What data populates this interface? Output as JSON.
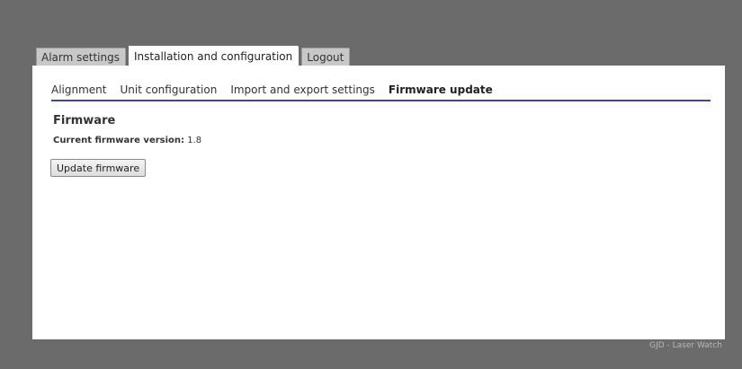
{
  "top_tabs": [
    {
      "label": "Alarm settings",
      "active": false
    },
    {
      "label": "Installation and configuration",
      "active": true
    },
    {
      "label": "Logout",
      "active": false
    }
  ],
  "sub_nav": [
    {
      "label": "Alignment",
      "active": false
    },
    {
      "label": "Unit configuration",
      "active": false
    },
    {
      "label": "Import and export settings",
      "active": false
    },
    {
      "label": "Firmware update",
      "active": true
    }
  ],
  "section": {
    "title": "Firmware",
    "version_label": "Current firmware version:",
    "version_value": "1.8",
    "update_button": "Update firmware"
  },
  "footer": "GJD - Laser Watch",
  "colors": {
    "background": "#6b6b6b",
    "panel": "#ffffff",
    "accent_line": "#3c4a8c"
  }
}
